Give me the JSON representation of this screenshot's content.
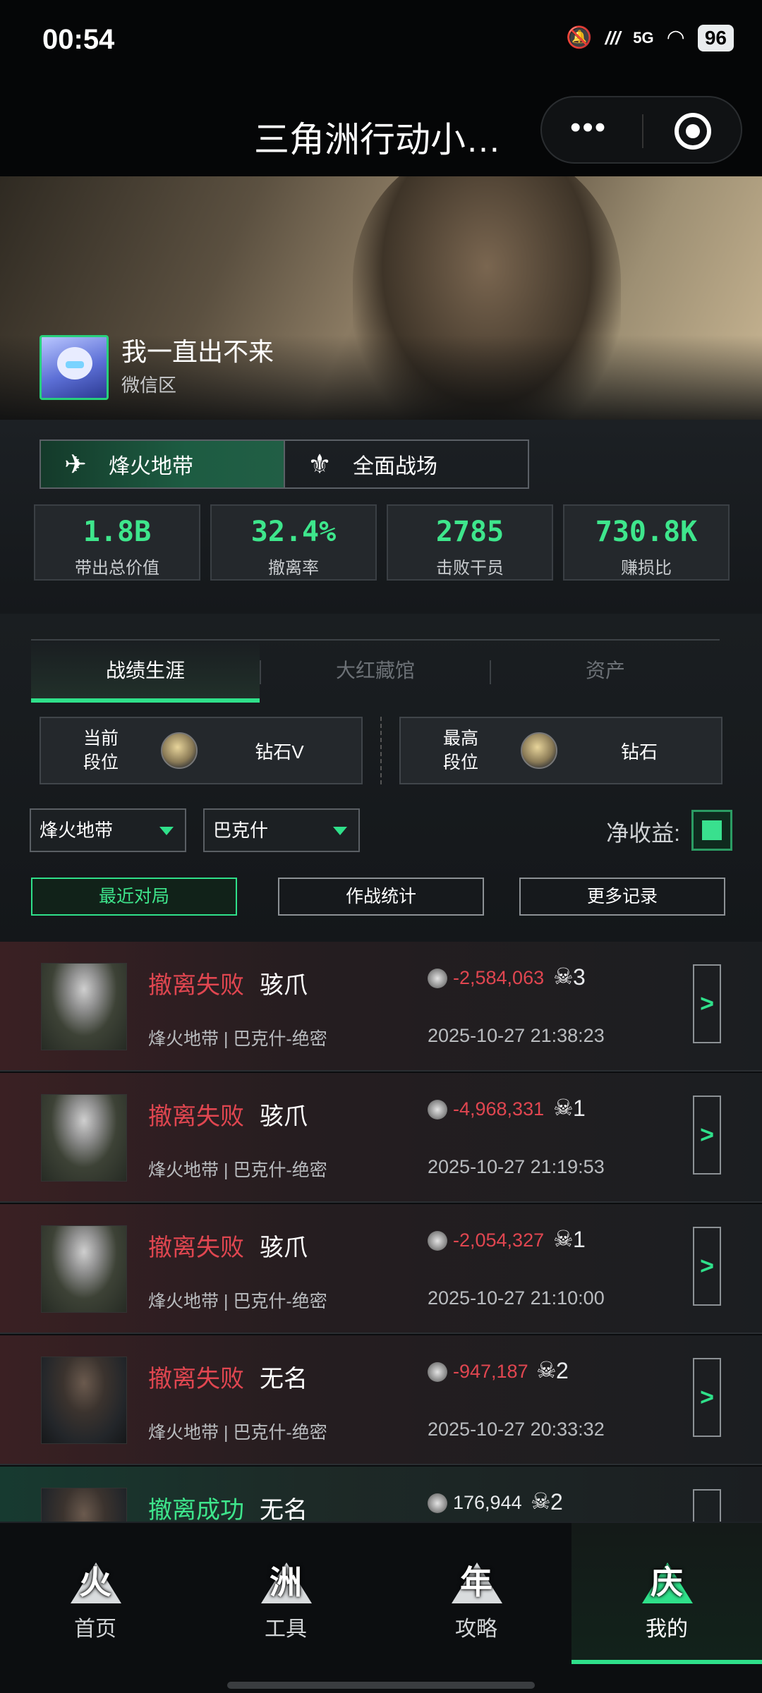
{
  "status_bar": {
    "time": "00:54",
    "network": "5G",
    "battery": "96",
    "icons": [
      "mute-icon",
      "hd-icon",
      "signal-icon",
      "wifi-icon",
      "battery-icon"
    ]
  },
  "title_bar": {
    "title": "三角洲行动小…",
    "more_label": "•••"
  },
  "profile": {
    "name": "我一直出不来",
    "region": "微信区"
  },
  "modes": [
    {
      "label": "烽火地带",
      "icon": "helicopter-icon",
      "active": true
    },
    {
      "label": "全面战场",
      "icon": "wings-icon",
      "active": false
    }
  ],
  "stats": [
    {
      "value": "1.8B",
      "label": "带出总价值"
    },
    {
      "value": "32.4%",
      "label": "撤离率"
    },
    {
      "value": "2785",
      "label": "击败干员"
    },
    {
      "value": "730.8K",
      "label": "赚损比"
    }
  ],
  "section_tabs": [
    {
      "label": "战绩生涯",
      "active": true
    },
    {
      "label": "大红藏馆",
      "active": false
    },
    {
      "label": "资产",
      "active": false
    }
  ],
  "rank": {
    "current": {
      "label_line1": "当前",
      "label_line2": "段位",
      "value": "钻石V"
    },
    "highest": {
      "label_line1": "最高",
      "label_line2": "段位",
      "value": "钻石"
    }
  },
  "filters": {
    "mode_select": "烽火地带",
    "map_select": "巴克什",
    "net_income_label": "净收益:",
    "net_income_checked": true
  },
  "buttons": {
    "recent": "最近对局",
    "battle_stats": "作战统计",
    "more_records": "更多记录"
  },
  "records": [
    {
      "status": "撤离失败",
      "operator": "骇爪",
      "map": "烽火地带 | 巴克什-绝密",
      "value": "-2,584,063",
      "kills": "3",
      "time": "2025-10-27 21:38:23",
      "success": false
    },
    {
      "status": "撤离失败",
      "operator": "骇爪",
      "map": "烽火地带 | 巴克什-绝密",
      "value": "-4,968,331",
      "kills": "1",
      "time": "2025-10-27 21:19:53",
      "success": false
    },
    {
      "status": "撤离失败",
      "operator": "骇爪",
      "map": "烽火地带 | 巴克什-绝密",
      "value": "-2,054,327",
      "kills": "1",
      "time": "2025-10-27 21:10:00",
      "success": false
    },
    {
      "status": "撤离失败",
      "operator": "无名",
      "map": "烽火地带 | 巴克什-绝密",
      "value": "-947,187",
      "kills": "2",
      "time": "2025-10-27 20:33:32",
      "success": false
    },
    {
      "status": "撤离成功",
      "operator": "无名",
      "map": "",
      "value": "176,944",
      "kills": "2",
      "time": "",
      "success": true
    }
  ],
  "record_arrow": ">",
  "nav": [
    {
      "label": "首页",
      "glyph": "火",
      "icon": "home-triangle-icon",
      "active": false
    },
    {
      "label": "工具",
      "glyph": "洲",
      "icon": "tools-triangle-icon",
      "active": false
    },
    {
      "label": "攻略",
      "glyph": "年",
      "icon": "guide-triangle-icon",
      "active": false
    },
    {
      "label": "我的",
      "glyph": "庆",
      "icon": "profile-triangle-icon",
      "active": true
    }
  ],
  "colors": {
    "accent": "#2fe08a",
    "stat_green": "#3ee68c",
    "fail_red": "#e04650",
    "background": "#0b0d0f"
  }
}
